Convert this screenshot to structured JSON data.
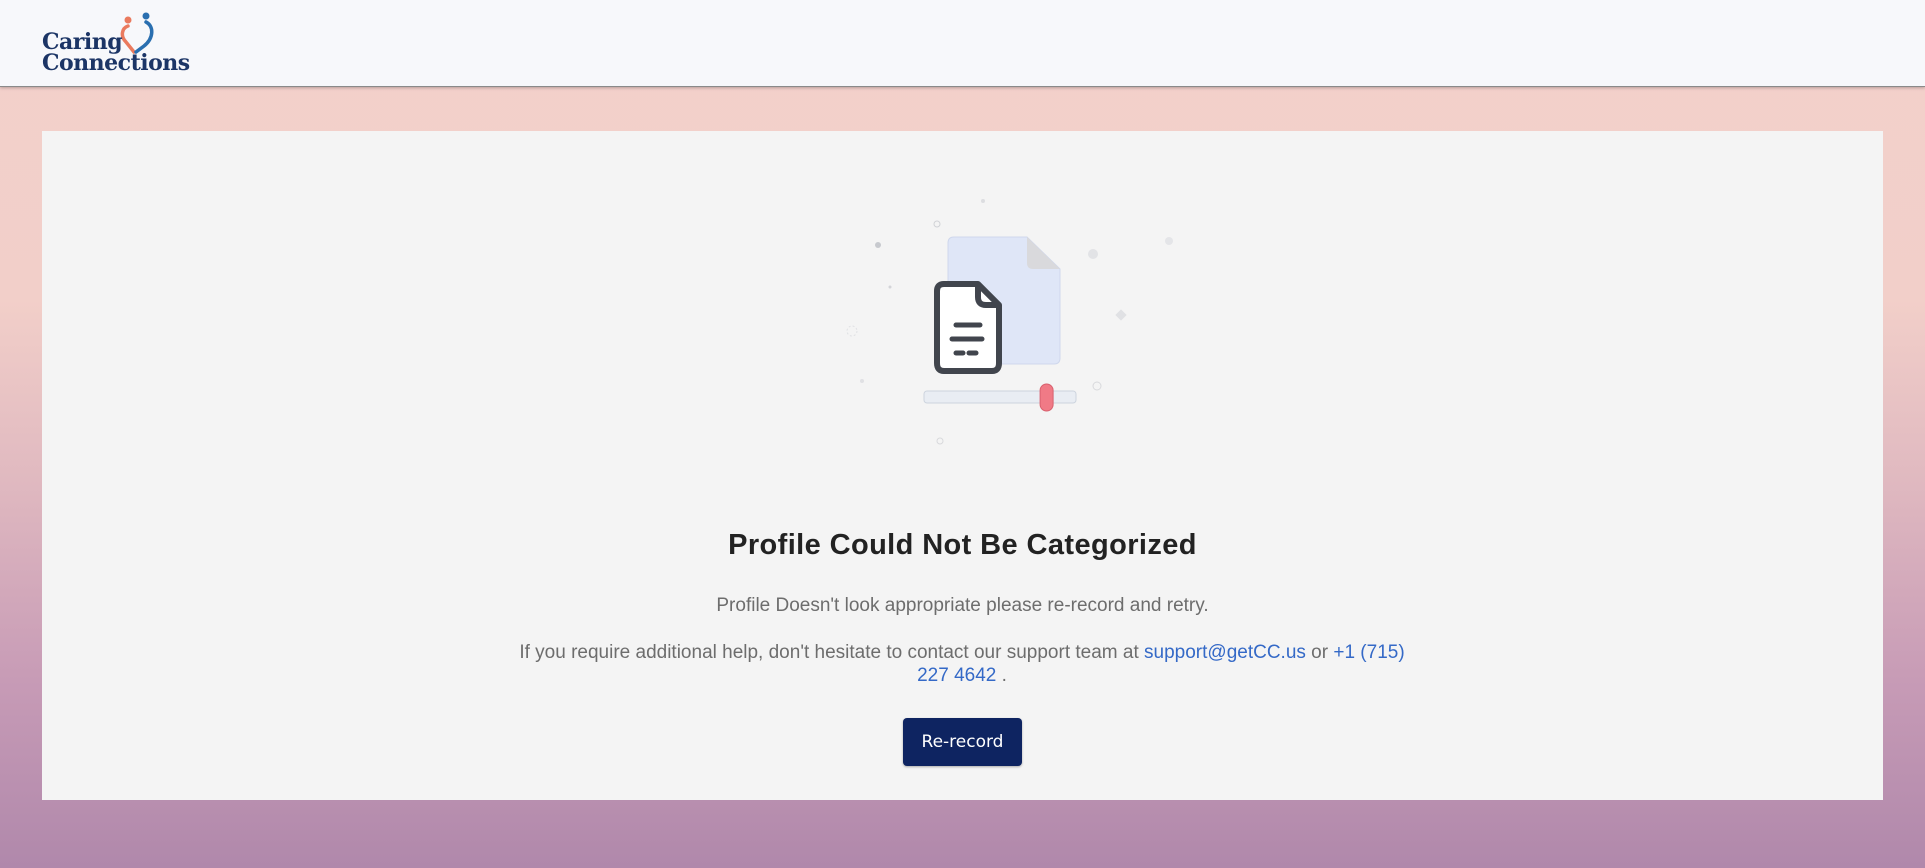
{
  "header": {
    "logo_line1": "Caring",
    "logo_line2": "Connections",
    "logo_icon": "heart-people-icon"
  },
  "illustration": {
    "icon": "document-icon",
    "progress_fraction": 0.8
  },
  "content": {
    "title": "Profile Could Not Be Categorized",
    "message": "Profile Doesn't look appropriate please re-record and retry.",
    "help_prefix": "If you require additional help, don't hesitate to contact our support team at ",
    "support_email": "support@getCC.us",
    "help_or": " or ",
    "support_phone": "+1 (715) 227 4642",
    "help_suffix": " ."
  },
  "actions": {
    "rerecord_label": "Re-record"
  },
  "colors": {
    "brand_navy": "#1c3566",
    "button": "#0e2461",
    "link": "#3469c7",
    "accent_coral": "#f07a86"
  }
}
